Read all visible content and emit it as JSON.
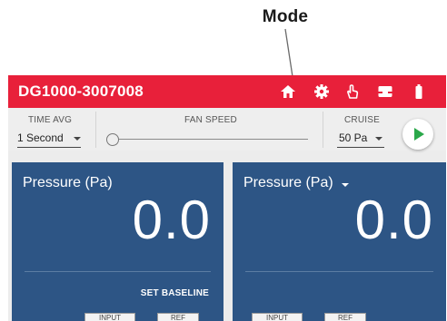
{
  "annotation": {
    "label": "Mode"
  },
  "app": {
    "title": "DG1000-3007008",
    "icons": [
      "home-icon",
      "gear-icon",
      "touch-gesture-icon",
      "inbox-icon",
      "battery-icon"
    ],
    "colors": {
      "header": "#e8203a",
      "panel": "#2d5585",
      "toolbar": "#eeeeee",
      "play": "#2aa84a"
    }
  },
  "toolbar": {
    "time_avg": {
      "label": "TIME AVG",
      "value": "1 Second"
    },
    "fan_speed": {
      "label": "FAN SPEED"
    },
    "cruise": {
      "label": "CRUISE",
      "value": "50 Pa"
    }
  },
  "panels": [
    {
      "title": "Pressure (Pa)",
      "value": "0.0",
      "action": "SET BASELINE"
    },
    {
      "title": "Pressure (Pa)",
      "value": "0.0"
    }
  ],
  "bottom_tabs": [
    "INPUT",
    "REF",
    "INPUT",
    "REF"
  ]
}
